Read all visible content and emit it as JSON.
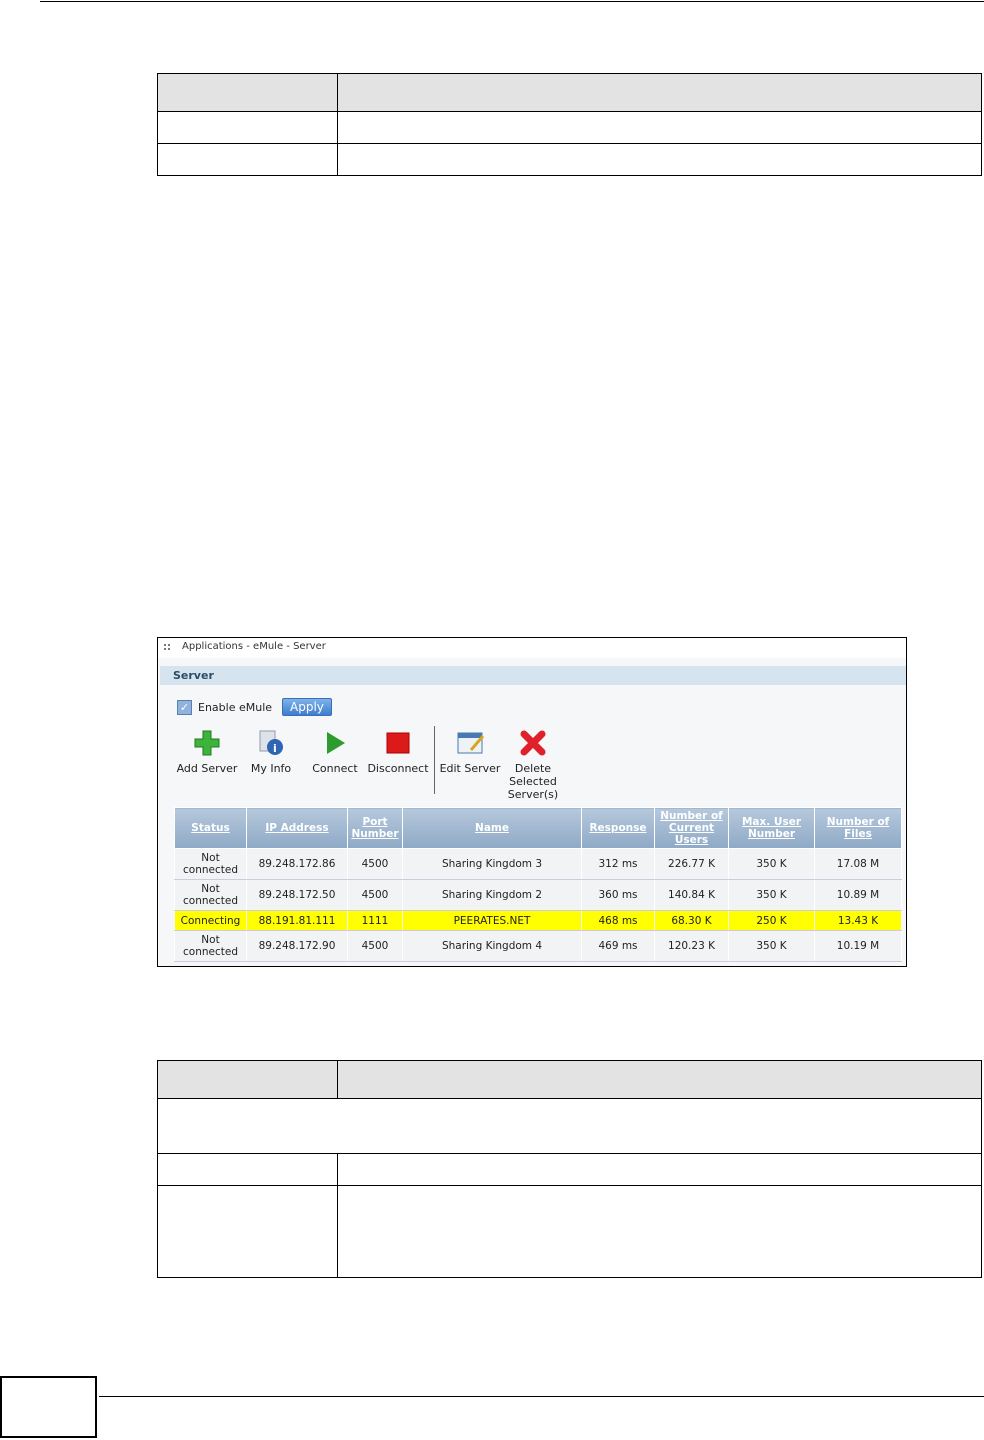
{
  "window_title": "Applications - eMule - Server",
  "section": "Server",
  "enable_label": "Enable eMule",
  "apply_label": "Apply",
  "toolbar": [
    {
      "label": "Add Server",
      "icon": "plus-icon"
    },
    {
      "label": "My Info",
      "icon": "info-icon"
    },
    {
      "label": "Connect",
      "icon": "play-icon"
    },
    {
      "label": "Disconnect",
      "icon": "stop-icon"
    },
    {
      "label": "Edit Server",
      "icon": "edit-icon"
    },
    {
      "label": "Delete Selected Server(s)",
      "icon": "delete-icon"
    }
  ],
  "columns": [
    "Status",
    "IP Address",
    "Port Number",
    "Name",
    "Response",
    "Number of Current Users",
    "Max. User Number",
    "Number of Files"
  ],
  "rows": [
    [
      "Not connected",
      "89.248.172.86",
      "4500",
      "Sharing Kingdom 3",
      "312 ms",
      "226.77 K",
      "350 K",
      "17.08 M"
    ],
    [
      "Not connected",
      "89.248.172.50",
      "4500",
      "Sharing Kingdom 2",
      "360 ms",
      "140.84 K",
      "350 K",
      "10.89 M"
    ],
    [
      "Connecting",
      "88.191.81.111",
      "1111",
      "PEERATES.NET",
      "468 ms",
      "68.30 K",
      "250 K",
      "13.43 K"
    ],
    [
      "Not connected",
      "89.248.172.90",
      "4500",
      "Sharing Kingdom 4",
      "469 ms",
      "120.23 K",
      "350 K",
      "10.19 M"
    ]
  ],
  "highlight_color": "#ffff00"
}
